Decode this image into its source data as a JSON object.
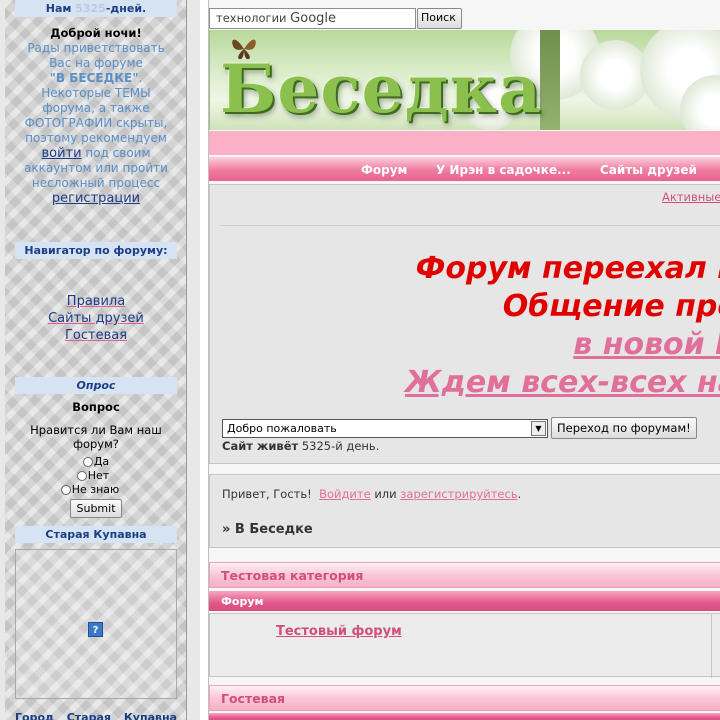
{
  "sidebar": {
    "days_prefix": "Нам ",
    "days_number": "5325",
    "days_suffix": "-дней.",
    "greeting": "Доброй ночи!",
    "welcome_line": "Рады приветствовать Вас на форуме",
    "forum_name": "\"В БЕСЕДКЕ\"",
    "welcome_dot": ".",
    "hidden_text": "Некоторые ТЕМЫ форума, а также ФОТОГРАФИИ скрыты, поэтому рекомендуем",
    "login_link": "войти",
    "mid_text": "под своим аккаунтом или пройти несложный процесс",
    "register_link": "регистрации",
    "navigator_title": "Навигатор по форуму:",
    "nav_links": [
      "Правила",
      "Сайты друзей",
      "Гостевая"
    ],
    "poll_title": "Опрос",
    "poll_question_label": "Вопрос",
    "poll_question": "Нравится ли Вам наш форум?",
    "poll_options": [
      "Да",
      "Нет",
      "Не знаю"
    ],
    "poll_submit": "Submit",
    "town_title": "Старая Купавна",
    "help_icon": "?",
    "town_text": "Город Старая Купавна расположен на левом"
  },
  "search": {
    "value": "технологии",
    "google_word": "Google",
    "button": "Поиск"
  },
  "banner": {
    "title": "Беседка"
  },
  "nav": {
    "items": [
      "Форум",
      "У Ирэн в садочке...",
      "Сайты друзей"
    ]
  },
  "content": {
    "active_link": "Активные",
    "announce_1": "Форум переехал н",
    "announce_2": "Общение про",
    "announce_3": "в новой Б",
    "announce_4": "Ждем всех-всех на",
    "select_value": "Добро пожаловать",
    "go_button": "Переход по форумам!",
    "alive_label": "Сайт живёт",
    "alive_value": "5325-й день."
  },
  "guest": {
    "hello": "Привет, Гость!",
    "login": "Войдите",
    "or": "или",
    "register": "зарегистрируйтесь",
    "dot": ".",
    "breadcrumb": "» В Беседке"
  },
  "categories": [
    {
      "title": "Тестовая категория",
      "sub": "Форум",
      "forum": "Тестовый форум"
    },
    {
      "title": "Гостевая"
    }
  ],
  "colors": {
    "accent_pink": "#e2588a",
    "announce_red": "#e00000",
    "announce_pink": "#e0709a",
    "sidebar_head": "#1b3f84"
  }
}
